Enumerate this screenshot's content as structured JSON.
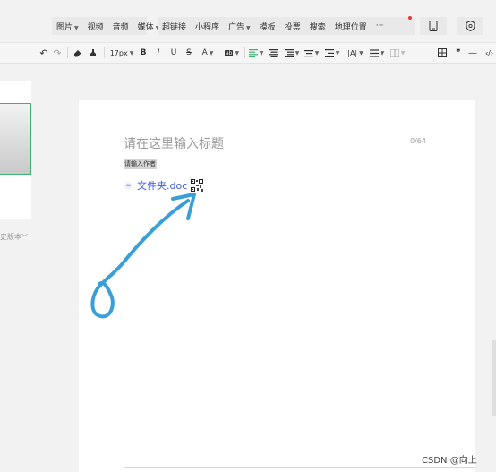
{
  "window": {
    "minimize": "–",
    "restore": "◰"
  },
  "menu": {
    "group1": [
      {
        "label": "图片",
        "dropdown": true
      },
      {
        "label": "视频",
        "dropdown": false
      },
      {
        "label": "音频",
        "dropdown": false
      },
      {
        "label": "媒体",
        "dropdown": true
      }
    ],
    "group2": [
      {
        "label": "超链接",
        "dropdown": false
      },
      {
        "label": "小程序",
        "dropdown": false
      },
      {
        "label": "广告",
        "dropdown": true
      },
      {
        "label": "模板",
        "dropdown": false
      },
      {
        "label": "投票",
        "dropdown": false
      },
      {
        "label": "搜索",
        "dropdown": false
      },
      {
        "label": "地理位置",
        "dropdown": false
      },
      {
        "label": "···",
        "dropdown": false
      }
    ],
    "more_has_notification": true,
    "notification_color": "#e53935"
  },
  "format_toolbar": {
    "undo": "↶",
    "redo": "↷",
    "font_size": "17px",
    "bold": "B",
    "italic": "I",
    "underline": "U",
    "strikethrough": "S",
    "font_color": "A",
    "bg_color": "ab",
    "quote": "❞",
    "divider": "—",
    "code": "‹/›"
  },
  "left_panel": {
    "history_label": "史版本"
  },
  "editor": {
    "title_placeholder": "请在这里输入标题",
    "title_counter": "0/64",
    "author_placeholder": "请输入作者",
    "attachment_name": "文件夹.doc"
  },
  "annotation": {
    "arrow_color": "#3a9fd8"
  },
  "watermark": "CSDN @向上",
  "colors": {
    "accent_green": "#3cb371",
    "link_blue": "#3b5bdb",
    "page_bg": "#f2f2f2"
  }
}
